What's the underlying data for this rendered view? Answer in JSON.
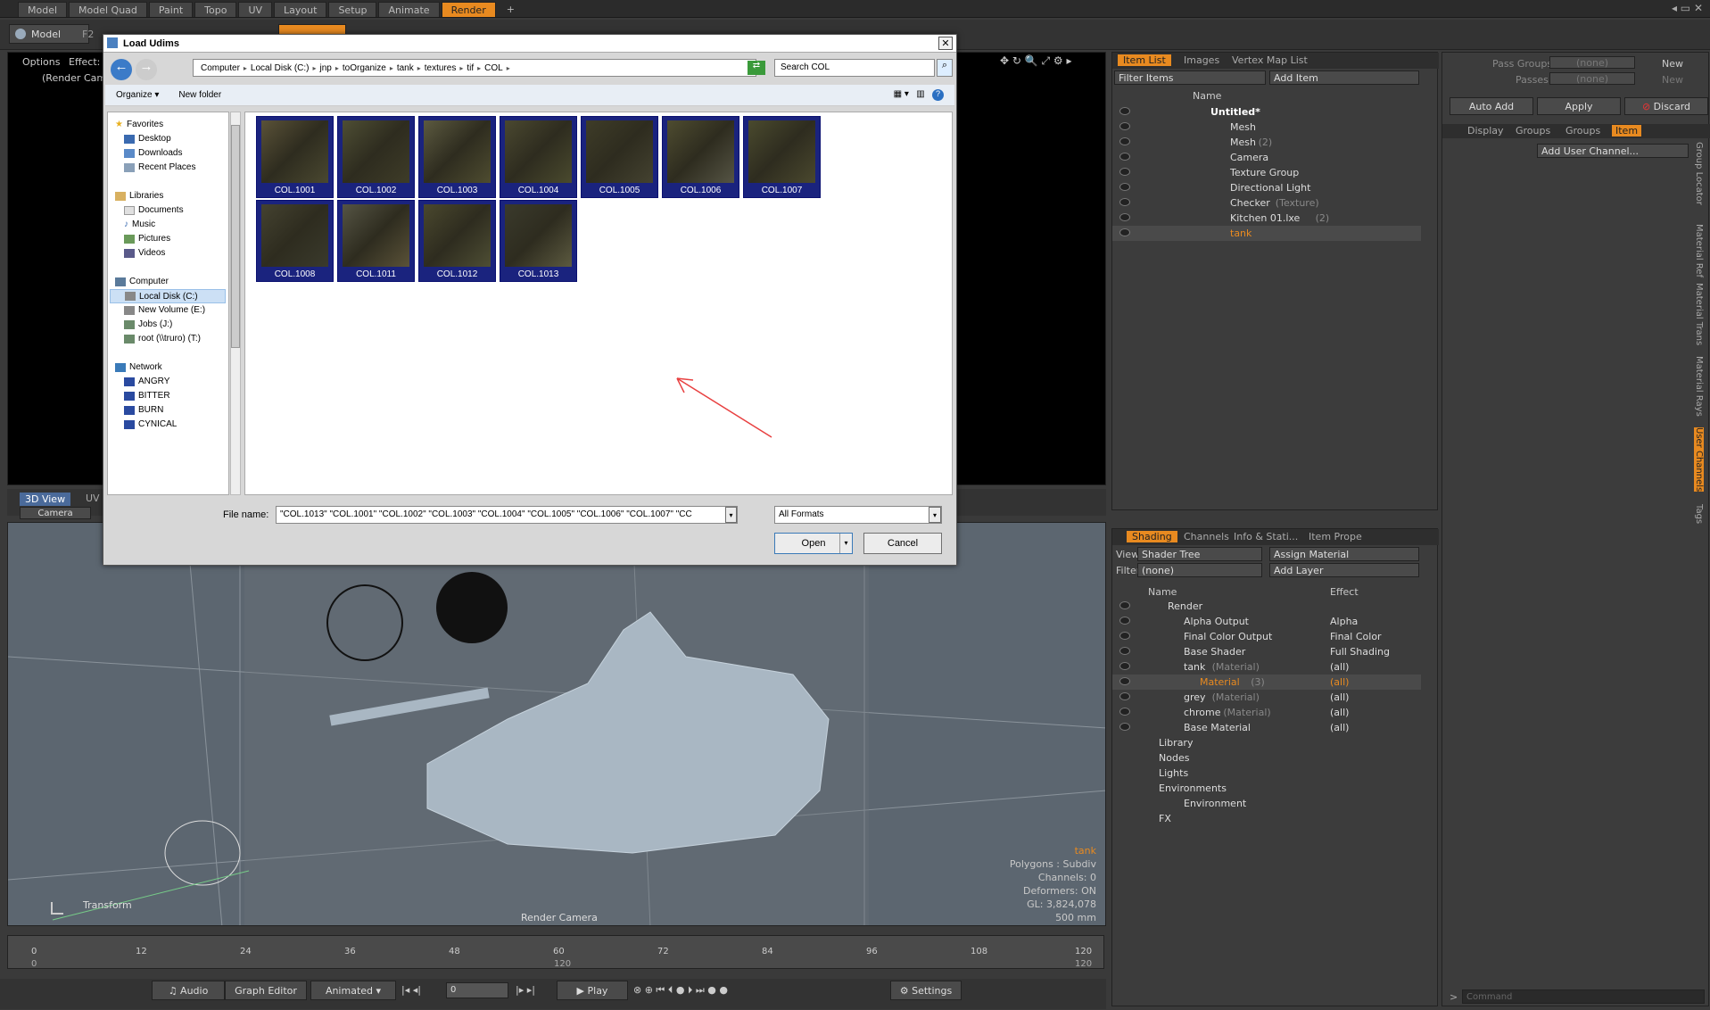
{
  "top_tabs": [
    "Model",
    "Model Quad",
    "Paint",
    "Topo",
    "UV",
    "Layout",
    "Setup",
    "Animate",
    "Render"
  ],
  "active_top_tab": "Render",
  "toolbar": {
    "model_label": "Model",
    "f2": "F2"
  },
  "render_view": {
    "options": "Options",
    "effect": "Effect:",
    "camera": "(Render Came"
  },
  "dialog": {
    "title": "Load Udims",
    "breadcrumb": [
      "Computer",
      "Local Disk (C:)",
      "jnp",
      "toOrganize",
      "tank",
      "textures",
      "tif",
      "COL"
    ],
    "search_placeholder": "Search COL",
    "organize": "Organize",
    "new_folder": "New folder",
    "nav": {
      "favorites": "Favorites",
      "desktop": "Desktop",
      "downloads": "Downloads",
      "recent": "Recent Places",
      "libraries": "Libraries",
      "documents": "Documents",
      "music": "Music",
      "pictures": "Pictures",
      "videos": "Videos",
      "computer": "Computer",
      "local_disk": "Local Disk (C:)",
      "new_volume": "New Volume (E:)",
      "jobs": "Jobs (J:)",
      "root": "root (\\\\truro) (T:)",
      "network": "Network",
      "angry": "ANGRY",
      "bitter": "BITTER",
      "burn": "BURN",
      "cynical": "CYNICAL"
    },
    "files": [
      "COL.1001",
      "COL.1002",
      "COL.1003",
      "COL.1004",
      "COL.1005",
      "COL.1006",
      "COL.1007",
      "COL.1008",
      "COL.1011",
      "COL.1012",
      "COL.1013"
    ],
    "file_name_label": "File name:",
    "file_name_value": "\"COL.1013\" \"COL.1001\" \"COL.1002\" \"COL.1003\" \"COL.1004\" \"COL.1005\" \"COL.1006\" \"COL.1007\" \"CC",
    "format": "All Formats",
    "open": "Open",
    "cancel": "Cancel"
  },
  "viewport": {
    "tabs": [
      "3D View",
      "UV Te"
    ],
    "camera": "Camera",
    "transform": "Transform",
    "render_camera": "Render Camera",
    "info": {
      "name": "tank",
      "polygons": "Polygons : Subdiv",
      "channels": "Channels: 0",
      "deformers": "Deformers: ON",
      "gl": "GL: 3,824,078",
      "size": "500 mm"
    }
  },
  "timeline": {
    "ticks": [
      "0",
      "12",
      "24",
      "36",
      "48",
      "60",
      "72",
      "84",
      "96",
      "108",
      "120"
    ],
    "start": "0",
    "mid": "120",
    "end": "120"
  },
  "bottom": {
    "audio": "Audio",
    "graph_editor": "Graph Editor",
    "animated": "Animated",
    "frame": "0",
    "play": "Play",
    "settings": "Settings"
  },
  "item_list": {
    "tabs": [
      "Item List",
      "Images",
      "Vertex Map List"
    ],
    "filter": "Filter Items",
    "add_item": "Add Item",
    "name_col": "Name",
    "items": [
      {
        "name": "Untitled*",
        "extra": ""
      },
      {
        "name": "Mesh",
        "extra": ""
      },
      {
        "name": "Mesh",
        "extra": "(2)"
      },
      {
        "name": "Camera",
        "extra": ""
      },
      {
        "name": "Texture Group",
        "extra": ""
      },
      {
        "name": "Directional Light",
        "extra": ""
      },
      {
        "name": "Checker",
        "extra": "(Texture)"
      },
      {
        "name": "Kitchen 01.lxe",
        "extra": "(2)"
      },
      {
        "name": "tank",
        "extra": ""
      }
    ]
  },
  "shading": {
    "tabs": [
      "Shading",
      "Channels",
      "Info & Stati...",
      "Item Prope"
    ],
    "view_label": "View",
    "view_value": "Shader Tree",
    "assign_material": "Assign Material",
    "filter_label": "Filter",
    "filter_value": "(none)",
    "add_layer": "Add Layer",
    "name_col": "Name",
    "effect_col": "Effect",
    "rows": [
      {
        "name": "Render",
        "extra": "",
        "effect": ""
      },
      {
        "name": "Alpha Output",
        "extra": "",
        "effect": "Alpha"
      },
      {
        "name": "Final Color Output",
        "extra": "",
        "effect": "Final Color"
      },
      {
        "name": "Base Shader",
        "extra": "",
        "effect": "Full Shading"
      },
      {
        "name": "tank",
        "extra": "(Material)",
        "effect": "(all)"
      },
      {
        "name": "Material",
        "extra": "(3)",
        "effect": "(all)"
      },
      {
        "name": "grey",
        "extra": "(Material)",
        "effect": "(all)"
      },
      {
        "name": "chrome",
        "extra": "(Material)",
        "effect": "(all)"
      },
      {
        "name": "Base Material",
        "extra": "",
        "effect": "(all)"
      },
      {
        "name": "Library",
        "extra": "",
        "effect": ""
      },
      {
        "name": "Nodes",
        "extra": "",
        "effect": ""
      },
      {
        "name": "Lights",
        "extra": "",
        "effect": ""
      },
      {
        "name": "Environments",
        "extra": "",
        "effect": ""
      },
      {
        "name": "Environment",
        "extra": "",
        "effect": ""
      },
      {
        "name": "FX",
        "extra": "",
        "effect": ""
      }
    ]
  },
  "right_panel": {
    "pass_groups": "Pass Groups",
    "passes": "Passes",
    "none": "(none)",
    "new": "New",
    "auto_add": "Auto Add",
    "apply": "Apply",
    "discard": "Discard",
    "tabs": [
      "Display",
      "Groups",
      "Groups",
      "Item"
    ],
    "add_user_channel": "Add User Channel...",
    "side_tabs": [
      "Group Locator",
      "Material Ref",
      "Material Trans",
      "Material Rays",
      "User Channels",
      "Tags"
    ],
    "command": "Command"
  }
}
